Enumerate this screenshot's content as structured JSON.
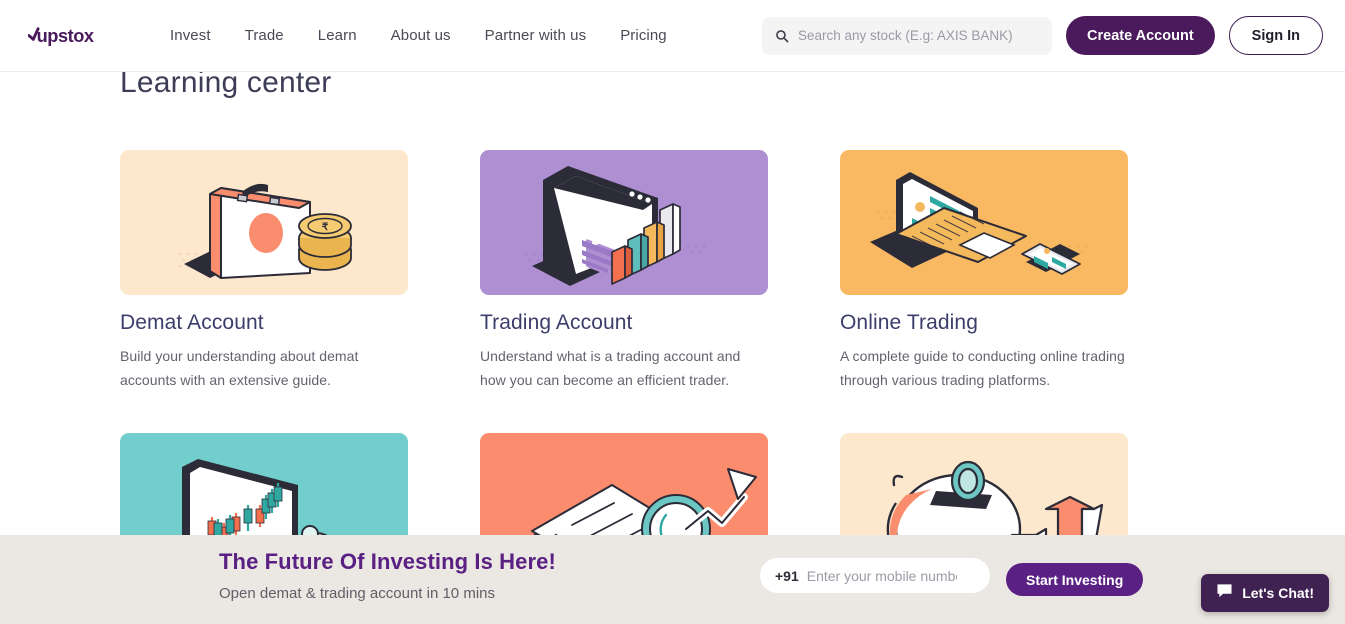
{
  "header": {
    "logo_text": "upstox",
    "logo_icon": "upstox-logo",
    "nav": [
      {
        "label": "Invest"
      },
      {
        "label": "Trade"
      },
      {
        "label": "Learn"
      },
      {
        "label": "About us"
      },
      {
        "label": "Partner with us"
      },
      {
        "label": "Pricing"
      }
    ],
    "search": {
      "icon": "search-icon",
      "placeholder": "Search any stock (E.g: AXIS BANK)",
      "value": ""
    },
    "create_account_label": "Create Account",
    "sign_in_label": "Sign In"
  },
  "main": {
    "title": "Learning center",
    "cards": [
      {
        "title": "Demat Account",
        "desc": "Build your understanding about demat accounts with an extensive guide.",
        "art": "briefcase-coins-illustration",
        "bg": "#FDE8CD"
      },
      {
        "title": "Trading Account",
        "desc": "Understand what is a trading account and how you can become an efficient trader.",
        "art": "browser-profile-chart-illustration",
        "bg": "#AE8FD2"
      },
      {
        "title": "Online Trading",
        "desc": "A complete guide to conducting online trading through various trading platforms.",
        "art": "laptop-phone-illustration",
        "bg": "#F9B963"
      },
      {
        "title": "",
        "desc": "",
        "art": "monitor-candlestick-clock-illustration",
        "bg": "#72CECD"
      },
      {
        "title": "",
        "desc": "",
        "art": "checklist-magnifier-arrow-illustration",
        "bg": "#FB8C6E"
      },
      {
        "title": "",
        "desc": "",
        "art": "piggybank-growth-arrow-illustration",
        "bg": "#FDE8CD"
      }
    ]
  },
  "banner": {
    "title": "The Future Of Investing Is Here!",
    "subtitle": "Open demat & trading account in 10 mins",
    "country_code": "+91",
    "phone_placeholder": "Enter your mobile number",
    "phone_value": "",
    "cta_label": "Start Investing"
  },
  "chat": {
    "label": "Let's Chat!",
    "icon": "chat-bubble-icon"
  },
  "colors": {
    "brand_purple": "#4a1a5c",
    "banner_purple": "#5b2083",
    "banner_bg": "#ebe7e2",
    "chat_bg": "#3f2152"
  }
}
